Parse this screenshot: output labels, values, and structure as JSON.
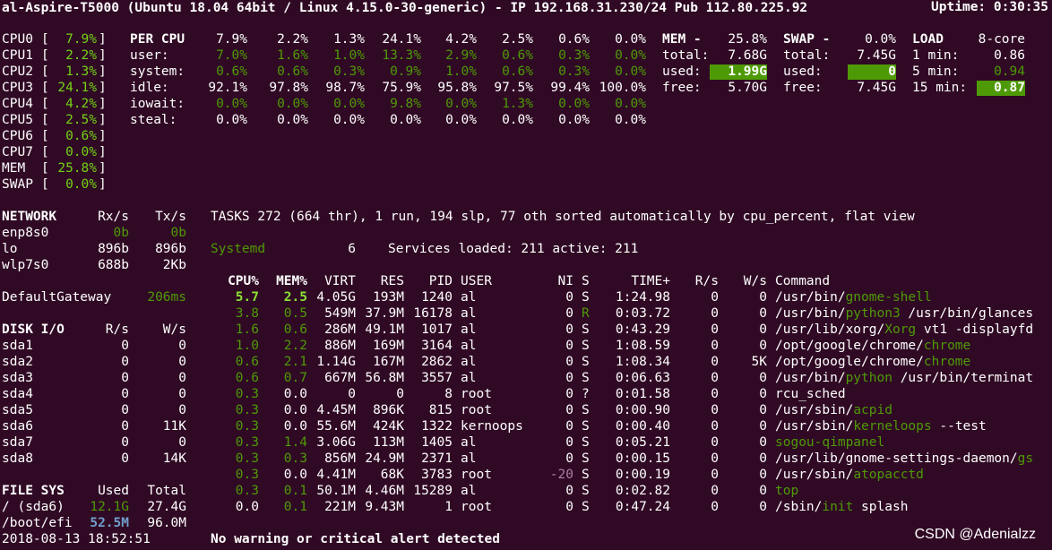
{
  "header": {
    "host_info": "al-Aspire-T5000 (Ubuntu 18.04 64bit / Linux 4.15.0-30-generic) - IP 192.168.31.230/24 Pub 112.80.225.92",
    "uptime": "Uptime: 0:30:35"
  },
  "cpu_bars": [
    {
      "label": "CPU0",
      "value": "7.9%"
    },
    {
      "label": "CPU1",
      "value": "2.2%"
    },
    {
      "label": "CPU2",
      "value": "1.3%"
    },
    {
      "label": "CPU3",
      "value": "24.1%"
    },
    {
      "label": "CPU4",
      "value": "4.2%"
    },
    {
      "label": "CPU5",
      "value": "2.5%"
    },
    {
      "label": "CPU6",
      "value": "0.6%"
    },
    {
      "label": "CPU7",
      "value": "0.0%"
    },
    {
      "label": "MEM",
      "value": "25.8%"
    },
    {
      "label": "SWAP",
      "value": "0.0%"
    }
  ],
  "percpu": {
    "title": "PER CPU",
    "header": [
      "7.9%",
      "2.2%",
      "1.3%",
      "24.1%",
      "4.2%",
      "2.5%",
      "0.6%",
      "0.0%"
    ],
    "rows": [
      {
        "label": "user:",
        "values": [
          "7.0%",
          "1.6%",
          "1.0%",
          "13.3%",
          "2.9%",
          "0.6%",
          "0.3%",
          "0.0%"
        ]
      },
      {
        "label": "system:",
        "values": [
          "0.6%",
          "0.6%",
          "0.3%",
          "0.9%",
          "1.0%",
          "0.6%",
          "0.3%",
          "0.0%"
        ]
      },
      {
        "label": "idle:",
        "values": [
          "92.1%",
          "97.8%",
          "98.7%",
          "75.9%",
          "95.8%",
          "97.5%",
          "99.4%",
          "100.0%"
        ]
      },
      {
        "label": "iowait:",
        "values": [
          "0.0%",
          "0.0%",
          "0.0%",
          "9.8%",
          "0.0%",
          "1.3%",
          "0.0%",
          "0.0%"
        ]
      },
      {
        "label": "steal:",
        "values": [
          "0.0%",
          "0.0%",
          "0.0%",
          "0.0%",
          "0.0%",
          "0.0%",
          "0.0%",
          "0.0%"
        ]
      }
    ]
  },
  "mem": {
    "title": "MEM -",
    "pct": "25.8%",
    "total_label": "total:",
    "total": "7.68G",
    "used_label": "used:",
    "used": "1.99G",
    "free_label": "free:",
    "free": "5.70G"
  },
  "swap": {
    "title": "SWAP -",
    "pct": "0.0%",
    "total_label": "total:",
    "total": "7.45G",
    "used_label": "used:",
    "used": "0",
    "free_label": "free:",
    "free": "7.45G"
  },
  "load": {
    "title": "LOAD",
    "cores": "8-core",
    "m1_label": "1 min:",
    "m1": "0.86",
    "m5_label": "5 min:",
    "m5": "0.94",
    "m15_label": "15 min:",
    "m15": "0.87"
  },
  "network": {
    "headers": [
      "NETWORK",
      "Rx/s",
      "Tx/s"
    ],
    "rows": [
      [
        "enp8s0",
        "0b",
        "0b"
      ],
      [
        "lo",
        "896b",
        "896b"
      ],
      [
        "wlp7s0",
        "688b",
        "2Kb"
      ]
    ]
  },
  "gateway": {
    "label": "DefaultGateway",
    "value": "206ms"
  },
  "disk": {
    "headers": [
      "DISK I/O",
      "R/s",
      "W/s"
    ],
    "rows": [
      [
        "sda1",
        "0",
        "0"
      ],
      [
        "sda2",
        "0",
        "0"
      ],
      [
        "sda3",
        "0",
        "0"
      ],
      [
        "sda4",
        "0",
        "0"
      ],
      [
        "sda5",
        "0",
        "0"
      ],
      [
        "sda6",
        "0",
        "11K"
      ],
      [
        "sda7",
        "0",
        "0"
      ],
      [
        "sda8",
        "0",
        "14K"
      ]
    ]
  },
  "filesys": {
    "headers": [
      "FILE SYS",
      "Used",
      "Total"
    ],
    "rows": [
      [
        "/ (sda6)",
        "12.1G",
        "27.4G"
      ],
      [
        "/boot/efi",
        "52.5M",
        "96.0M"
      ]
    ]
  },
  "timestamp": "2018-08-13 18:52:51",
  "tasks": {
    "line": "TASKS 272 (664 thr), 1 run, 194 slp, 77 oth sorted automatically by cpu_percent, flat view",
    "systemd_label": "Systemd",
    "systemd_count": "6",
    "services": "Services loaded: 211 active: 211"
  },
  "process_table": {
    "headers": [
      "CPU%",
      "MEM%",
      "VIRT",
      "RES",
      "PID",
      "USER",
      "NI",
      "S",
      "TIME+",
      "R/s",
      "W/s",
      "Command"
    ],
    "rows": [
      {
        "cpu": "5.7",
        "mem": "2.5",
        "virt": "4.05G",
        "res": "193M",
        "pid": "1240",
        "user": "al",
        "ni": "0",
        "s": "S",
        "time": "1:24.98",
        "rs": "0",
        "ws": "0",
        "path": "/usr/bin/",
        "name": "gnome-shell",
        "args": ""
      },
      {
        "cpu": "3.8",
        "mem": "0.5",
        "virt": "549M",
        "res": "37.9M",
        "pid": "16178",
        "user": "al",
        "ni": "0",
        "s": "R",
        "time": "0:03.72",
        "rs": "0",
        "ws": "0",
        "path": "/usr/bin/",
        "name": "python3",
        "args": " /usr/bin/glances"
      },
      {
        "cpu": "1.6",
        "mem": "0.6",
        "virt": "286M",
        "res": "49.1M",
        "pid": "1017",
        "user": "al",
        "ni": "0",
        "s": "S",
        "time": "0:43.29",
        "rs": "0",
        "ws": "0",
        "path": "/usr/lib/xorg/",
        "name": "Xorg",
        "args": " vt1 -displayfd"
      },
      {
        "cpu": "1.0",
        "mem": "2.2",
        "virt": "886M",
        "res": "169M",
        "pid": "3164",
        "user": "al",
        "ni": "0",
        "s": "S",
        "time": "1:08.59",
        "rs": "0",
        "ws": "0",
        "path": "/opt/google/chrome/",
        "name": "chrome",
        "args": ""
      },
      {
        "cpu": "0.6",
        "mem": "2.1",
        "virt": "1.14G",
        "res": "167M",
        "pid": "2862",
        "user": "al",
        "ni": "0",
        "s": "S",
        "time": "1:08.34",
        "rs": "0",
        "ws": "5K",
        "path": "/opt/google/chrome/",
        "name": "chrome",
        "args": ""
      },
      {
        "cpu": "0.6",
        "mem": "0.7",
        "virt": "667M",
        "res": "56.8M",
        "pid": "3557",
        "user": "al",
        "ni": "0",
        "s": "S",
        "time": "0:06.63",
        "rs": "0",
        "ws": "0",
        "path": "/usr/bin/",
        "name": "python",
        "args": " /usr/bin/terminat"
      },
      {
        "cpu": "0.3",
        "mem": "0.0",
        "virt": "0",
        "res": "0",
        "pid": "8",
        "user": "root",
        "ni": "0",
        "s": "?",
        "time": "0:01.58",
        "rs": "0",
        "ws": "0",
        "path": "",
        "name": "",
        "args": "rcu_sched"
      },
      {
        "cpu": "0.3",
        "mem": "0.0",
        "virt": "4.45M",
        "res": "896K",
        "pid": "815",
        "user": "root",
        "ni": "0",
        "s": "S",
        "time": "0:00.90",
        "rs": "0",
        "ws": "0",
        "path": "/usr/sbin/",
        "name": "acpid",
        "args": ""
      },
      {
        "cpu": "0.3",
        "mem": "0.0",
        "virt": "55.6M",
        "res": "424K",
        "pid": "1322",
        "user": "kernoops",
        "ni": "0",
        "s": "S",
        "time": "0:00.40",
        "rs": "0",
        "ws": "0",
        "path": "/usr/sbin/",
        "name": "kerneloops",
        "args": " --test"
      },
      {
        "cpu": "0.3",
        "mem": "1.4",
        "virt": "3.06G",
        "res": "113M",
        "pid": "1405",
        "user": "al",
        "ni": "0",
        "s": "S",
        "time": "0:05.21",
        "rs": "0",
        "ws": "0",
        "path": "",
        "name": "sogou-qimpanel",
        "args": ""
      },
      {
        "cpu": "0.3",
        "mem": "0.3",
        "virt": "856M",
        "res": "24.9M",
        "pid": "2371",
        "user": "al",
        "ni": "0",
        "s": "S",
        "time": "0:00.15",
        "rs": "0",
        "ws": "0",
        "path": "/usr/lib/gnome-settings-daemon/",
        "name": "gs",
        "args": ""
      },
      {
        "cpu": "0.3",
        "mem": "0.0",
        "virt": "4.41M",
        "res": "68K",
        "pid": "3783",
        "user": "root",
        "ni": "-20",
        "s": "S",
        "time": "0:00.19",
        "rs": "0",
        "ws": "0",
        "path": "/usr/sbin/",
        "name": "atopacctd",
        "args": ""
      },
      {
        "cpu": "0.3",
        "mem": "0.1",
        "virt": "50.1M",
        "res": "4.46M",
        "pid": "15289",
        "user": "al",
        "ni": "0",
        "s": "S",
        "time": "0:02.82",
        "rs": "0",
        "ws": "0",
        "path": "",
        "name": "top",
        "args": ""
      },
      {
        "cpu": "0.0",
        "mem": "0.1",
        "virt": "221M",
        "res": "9.43M",
        "pid": "1",
        "user": "root",
        "ni": "0",
        "s": "S",
        "time": "0:47.24",
        "rs": "0",
        "ws": "0",
        "path": "/sbin/",
        "name": "init",
        "args": " splash"
      }
    ]
  },
  "alert": "No warning or critical alert detected",
  "watermark": "CSDN @Adenialzz",
  "colors": {
    "background": "#300a24",
    "green": "#8ae234",
    "dark_green": "#4e9a06",
    "blue": "#729fcf",
    "violet": "#ad7fa8"
  }
}
